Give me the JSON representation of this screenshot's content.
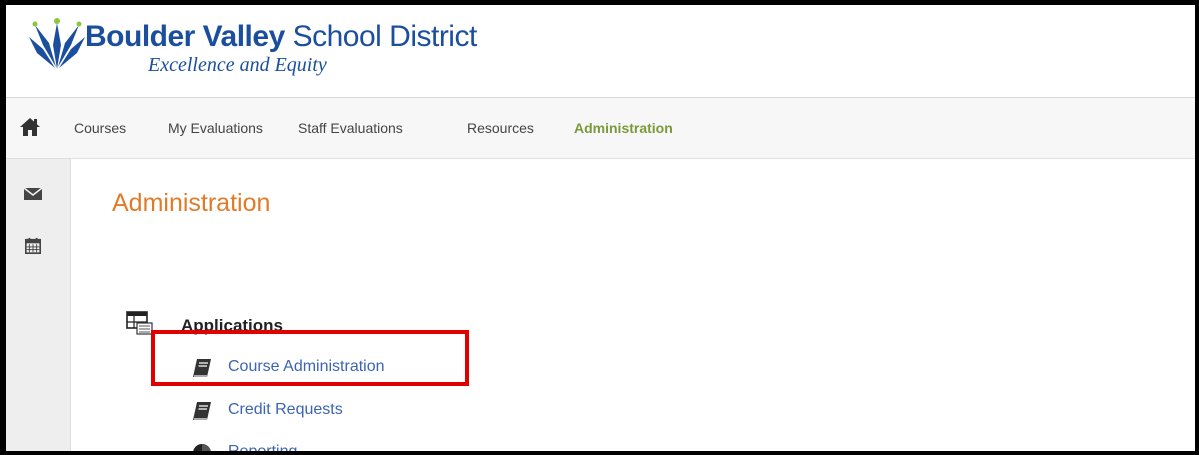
{
  "header": {
    "brand_bold": "Boulder Valley",
    "brand_rest": " School District",
    "tagline": "Excellence and Equity"
  },
  "nav": {
    "items": [
      {
        "label": "Courses",
        "active": false
      },
      {
        "label": "My Evaluations",
        "active": false
      },
      {
        "label": "Staff Evaluations",
        "active": false
      },
      {
        "label": "Resources",
        "active": false
      },
      {
        "label": "Administration",
        "active": true
      }
    ]
  },
  "sidebar": {
    "icons": [
      "envelope-icon",
      "calendar-icon"
    ]
  },
  "main": {
    "title": "Administration",
    "applications_heading": "Applications",
    "links": [
      {
        "label": "Course Administration",
        "icon": "book-icon"
      },
      {
        "label": "Credit Requests",
        "icon": "book-icon"
      },
      {
        "label": "Reporting",
        "icon": "pie-chart-icon"
      }
    ],
    "highlighted": "Course Administration"
  },
  "colors": {
    "brand_blue": "#1b4f9e",
    "title_orange": "#e07b2a",
    "active_nav_green": "#7a9a3a",
    "link_blue": "#3c64b4",
    "highlight_red": "#e00000"
  }
}
